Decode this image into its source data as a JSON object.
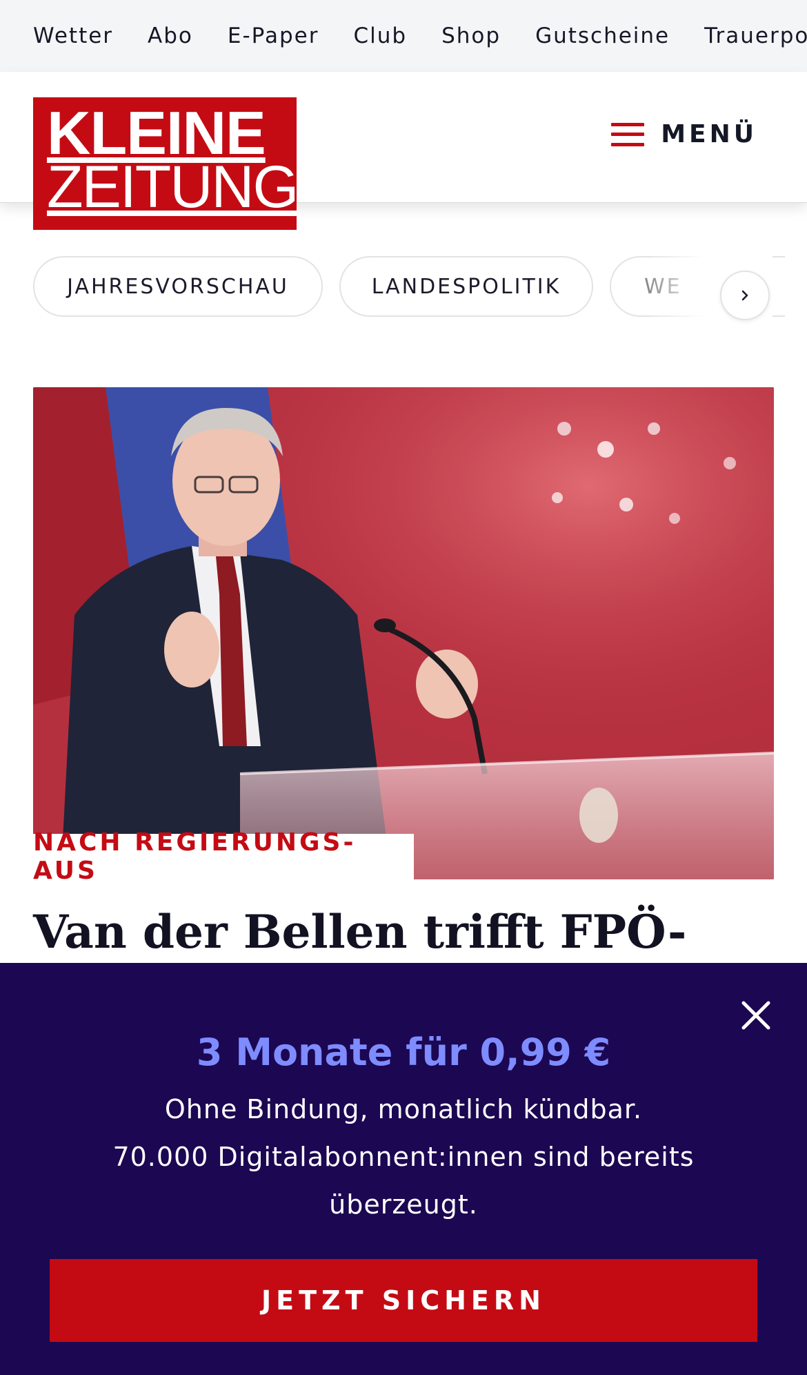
{
  "topnav": {
    "items": [
      "Wetter",
      "Abo",
      "E-Paper",
      "Club",
      "Shop",
      "Gutscheine",
      "Trauerpo"
    ]
  },
  "header": {
    "logo_line1": "KLEINE",
    "logo_line2": "ZEITUNG",
    "menu_label": "MENÜ"
  },
  "topics": {
    "chips": [
      "JAHRESVORSCHAU",
      "LANDESPOLITIK",
      "WE"
    ]
  },
  "article": {
    "kicker": "NACH REGIERUNGS-AUS",
    "headline": "Van der Bellen trifft FPÖ-Chef"
  },
  "paywall": {
    "offer": "3 Monate für 0,99 €",
    "line1": "Ohne Bindung, monatlich kündbar.",
    "line2": "70.000 Digitalabonnent:innen sind bereits überzeugt.",
    "cta": "JETZT SICHERN"
  },
  "icons": {
    "menu": "hamburger-icon",
    "chip_next": "chevron-right-icon",
    "close": "close-icon"
  },
  "colors": {
    "brand_red": "#c40b14",
    "overlay_bg": "#1c0752",
    "offer_blue": "#7e8cff",
    "topnav_bg": "#f4f5f7"
  }
}
